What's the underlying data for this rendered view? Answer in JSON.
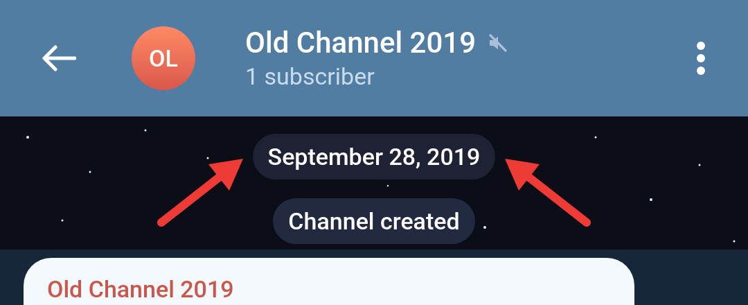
{
  "header": {
    "title": "Old Channel 2019",
    "muted": true,
    "subtitle": "1 subscriber",
    "avatar_initials": "OL"
  },
  "service_messages": [
    {
      "text": "September 28, 2019"
    },
    {
      "text": "Channel created"
    }
  ],
  "post": {
    "author": "Old Channel 2019"
  }
}
